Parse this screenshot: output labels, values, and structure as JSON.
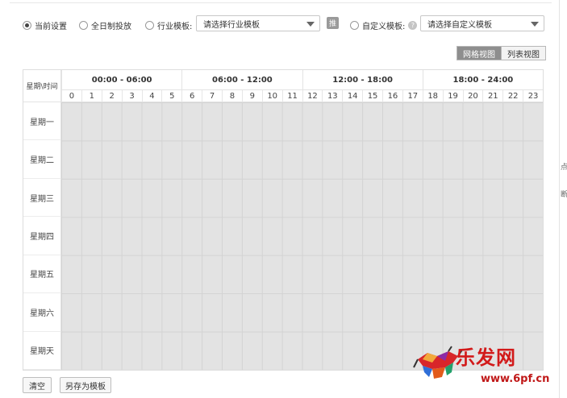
{
  "options": {
    "current": "当前设置",
    "allday": "全日制投放",
    "industry_label": "行业模板:",
    "industry_placeholder": "请选择行业模板",
    "recommend_label": "推",
    "custom_label": "自定义模板:",
    "custom_placeholder": "请选择自定义模板",
    "help_icon": "?"
  },
  "view": {
    "grid": "网格视图",
    "list": "列表视图"
  },
  "grid": {
    "corner": "星期\\时间",
    "periods": [
      "00:00 - 06:00",
      "06:00 - 12:00",
      "12:00 - 18:00",
      "18:00 - 24:00"
    ],
    "hours": [
      "0",
      "1",
      "2",
      "3",
      "4",
      "5",
      "6",
      "7",
      "8",
      "9",
      "10",
      "11",
      "12",
      "13",
      "14",
      "15",
      "16",
      "17",
      "18",
      "19",
      "20",
      "21",
      "22",
      "23"
    ],
    "days": [
      "星期一",
      "星期二",
      "星期三",
      "星期四",
      "星期五",
      "星期六",
      "星期天"
    ]
  },
  "buttons": {
    "clear": "清空",
    "save_template": "另存为模板"
  },
  "watermark": {
    "text": "乐发网",
    "url": "www.6pf.cn"
  },
  "edge_chars": [
    "点",
    "断"
  ],
  "colors": {
    "selected_view": "#8e8e8e",
    "cell": "#e3e3e3",
    "watermark": "#d21a1a"
  }
}
